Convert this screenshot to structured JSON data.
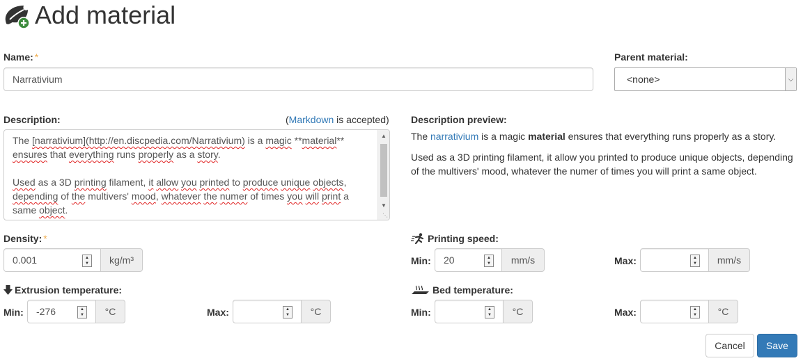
{
  "header": {
    "title": "Add material"
  },
  "name_field": {
    "label": "Name:",
    "required_mark": "*",
    "value": "Narrativium"
  },
  "parent_field": {
    "label": "Parent material:",
    "selected": "<none>"
  },
  "description": {
    "label": "Description:",
    "help_open": "(",
    "help_link": "Markdown",
    "help_rest": " is accepted)",
    "line1_a": "The ",
    "line1_b": "[narrativium](http://en.discpedia.com/Narrativium)",
    "line1_c": " is a ",
    "line1_d": "magic",
    "line1_e": " **",
    "line1_f": "material",
    "line1_g": "**",
    "line2_a": "ensures",
    "line2_b": " that ",
    "line2_c": "everything",
    "line2_d": " runs ",
    "line2_e": "properly",
    "line2_f": " as a ",
    "line2_g": "story",
    "line2_h": ".",
    "line3_a": "Used",
    "line3_b": " as a 3D ",
    "line3_c": "printing",
    "line3_d": " filament, ",
    "line3_e": "it",
    "line3_f": " ",
    "line3_g": "allow",
    "line3_h": " ",
    "line3_i": "you",
    "line3_j": " ",
    "line3_k": "printed",
    "line3_l": " to ",
    "line3_m": "produce",
    "line3_n": " ",
    "line3_o": "unique",
    "line3_p": " ",
    "line3_q": "objects",
    "line3_r": ",",
    "line4_a": "depending",
    "line4_b": " of ",
    "line4_c": "the",
    "line4_d": " multivers' ",
    "line4_e": "mood",
    "line4_f": ", ",
    "line4_g": "whatever",
    "line4_h": " ",
    "line4_i": "the",
    "line4_j": " ",
    "line4_k": "numer",
    "line4_l": " of times ",
    "line4_m": "you",
    "line4_n": " ",
    "line4_o": "will",
    "line4_p": " ",
    "line4_q": "print",
    "line4_r": " a",
    "line5_a": "same ",
    "line5_b": "object",
    "line5_c": "."
  },
  "preview": {
    "label": "Description preview:",
    "p1_a": "The ",
    "p1_link": "narrativium",
    "p1_b": " is a magic ",
    "p1_bold": "material",
    "p1_c": " ensures that everything runs properly as a story.",
    "p2": "Used as a 3D printing filament, it allow you printed to produce unique objects, depending of the multivers' mood, whatever the numer of times you will print a same object."
  },
  "density": {
    "label": "Density:",
    "required_mark": "*",
    "value": "0.001",
    "unit": "kg/m³"
  },
  "printing_speed": {
    "label": "Printing speed:",
    "min_label": "Min:",
    "min_value": "20",
    "max_label": "Max:",
    "max_value": "",
    "unit": "mm/s"
  },
  "extrusion_temp": {
    "label": "Extrusion temperature:",
    "min_label": "Min:",
    "min_value": "-276",
    "max_label": "Max:",
    "max_value": "",
    "unit": "°C"
  },
  "bed_temp": {
    "label": "Bed temperature:",
    "min_label": "Min:",
    "min_value": "",
    "max_label": "Max:",
    "max_value": "",
    "unit": "°C"
  },
  "actions": {
    "cancel": "Cancel",
    "save": "Save"
  }
}
